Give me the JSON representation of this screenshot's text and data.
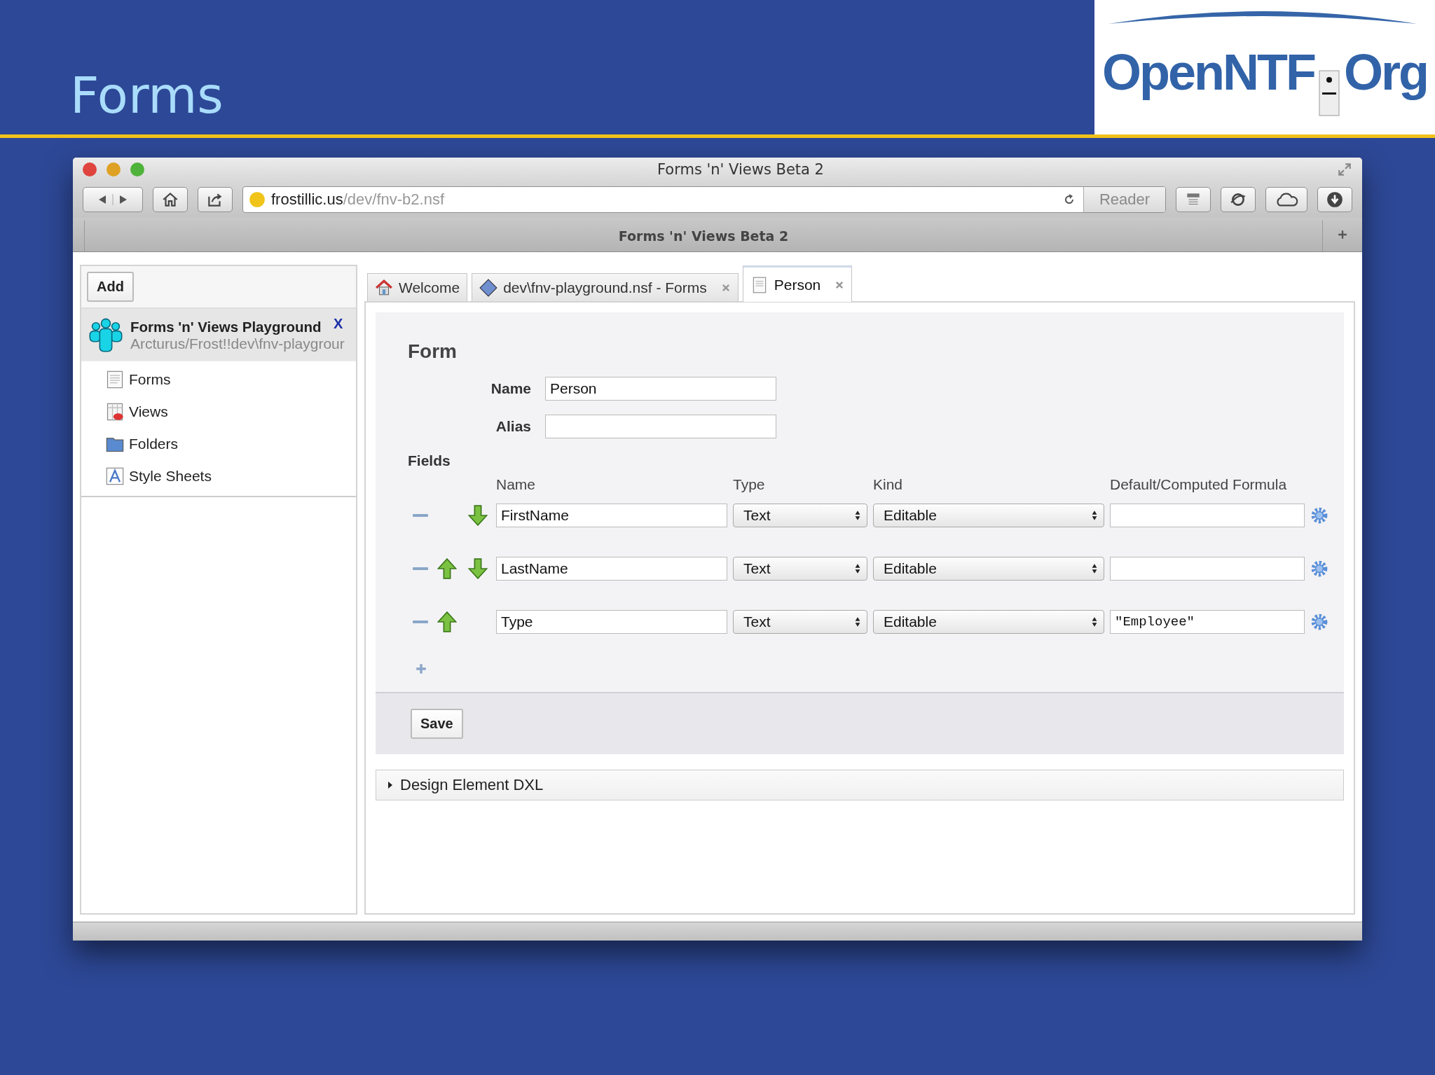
{
  "slide": {
    "title": "Forms",
    "logo_main": "OpenNTF",
    "logo_suffix": "Org"
  },
  "browser": {
    "title": "Forms 'n' Views Beta 2",
    "url_host": "frostillic.us",
    "url_path": "/dev/fnv-b2.nsf",
    "reader": "Reader",
    "tab_title": "Forms 'n' Views Beta 2"
  },
  "sidebar": {
    "add_button": "Add",
    "database": {
      "title": "Forms 'n' Views Playground",
      "path": "Arcturus/Frost!!dev\\fnv-playgrour",
      "close": "X",
      "selected": true
    },
    "items": [
      {
        "label": "Forms",
        "kind": "form"
      },
      {
        "label": "Views",
        "kind": "view"
      },
      {
        "label": "Folders",
        "kind": "folder"
      },
      {
        "label": "Style Sheets",
        "kind": "stylesheet"
      }
    ]
  },
  "tabs": [
    {
      "label": "Welcome",
      "kind": "home",
      "selected": false,
      "closable": false
    },
    {
      "label": "dev\\fnv-playground.nsf - Forms",
      "kind": "database",
      "selected": false,
      "closable": true
    },
    {
      "label": "Person",
      "kind": "document",
      "selected": true,
      "closable": true
    }
  ],
  "form": {
    "heading": "Form",
    "name_label": "Name",
    "name_value": "Person",
    "alias_label": "Alias",
    "fields_label": "Fields",
    "columns": [
      "Name",
      "Type",
      "Kind",
      "Default/Computed Formula"
    ],
    "rows": [
      {
        "name": "FirstName",
        "type": "Text",
        "kind": "Editable",
        "formula": "",
        "move_up": false,
        "move_down": true
      },
      {
        "name": "LastName",
        "type": "Text",
        "kind": "Editable",
        "formula": "",
        "move_up": true,
        "move_down": true
      },
      {
        "name": "Type",
        "type": "Text",
        "kind": "Editable",
        "formula": "\"Employee\"",
        "move_up": true,
        "move_down": false
      }
    ],
    "save_button": "Save"
  },
  "dxl_section": {
    "label": "Design Element DXL",
    "expanded": false
  }
}
